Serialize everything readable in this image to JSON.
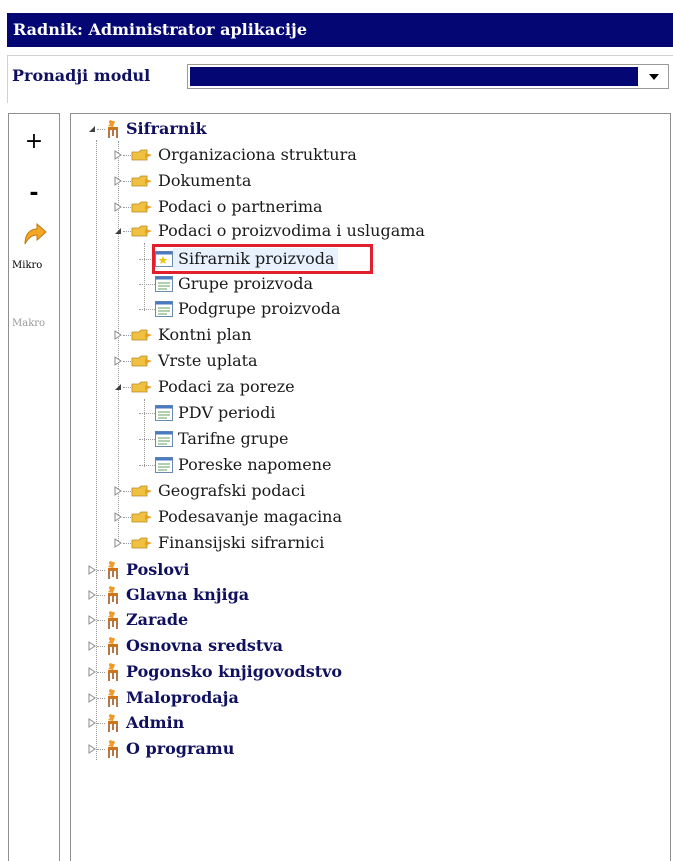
{
  "window": {
    "title": "Radnik: Administrator aplikacije"
  },
  "module_finder": {
    "label": "Pronadji modul",
    "value": ""
  },
  "toolbar": {
    "expand_label": "+",
    "collapse_label": "-",
    "mikro_label": "Mikro",
    "makro_label": "Makro"
  },
  "tree": {
    "sifrarnik": {
      "label": "Sifrarnik",
      "organizaciona_struktura": "Organizaciona struktura",
      "dokumenta": "Dokumenta",
      "podaci_o_partnerima": "Podaci o partnerima",
      "podaci_o_proizvodima": {
        "label": "Podaci o proizvodima i uslugama",
        "sifrarnik_proizvoda": "Sifrarnik proizvoda",
        "grupe_proizvoda": "Grupe proizvoda",
        "podgrupe_proizvoda": "Podgrupe proizvoda"
      },
      "kontni_plan": "Kontni plan",
      "vrste_uplata": "Vrste uplata",
      "podaci_za_poreze": {
        "label": "Podaci za poreze",
        "pdv_periodi": "PDV periodi",
        "tarifne_grupe": "Tarifne grupe",
        "poreske_napomene": "Poreske napomene"
      },
      "geografski_podaci": "Geografski podaci",
      "podesavanje_magacina": "Podesavanje magacina",
      "finansijski_sifrarnici": "Finansijski sifrarnici"
    },
    "poslovi": "Poslovi",
    "glavna_knjiga": "Glavna knjiga",
    "zarade": "Zarade",
    "osnovna_sredstva": "Osnovna sredstva",
    "pogonsko_knjigovodstvo": "Pogonsko knjigovodstvo",
    "maloprodaja": "Maloprodaja",
    "admin": "Admin",
    "o_programu": "O programu"
  },
  "colors": {
    "title_bar": "#040674",
    "highlight": "#e21f2c",
    "folder": "#f0c040",
    "module_icon": "#e08018"
  }
}
